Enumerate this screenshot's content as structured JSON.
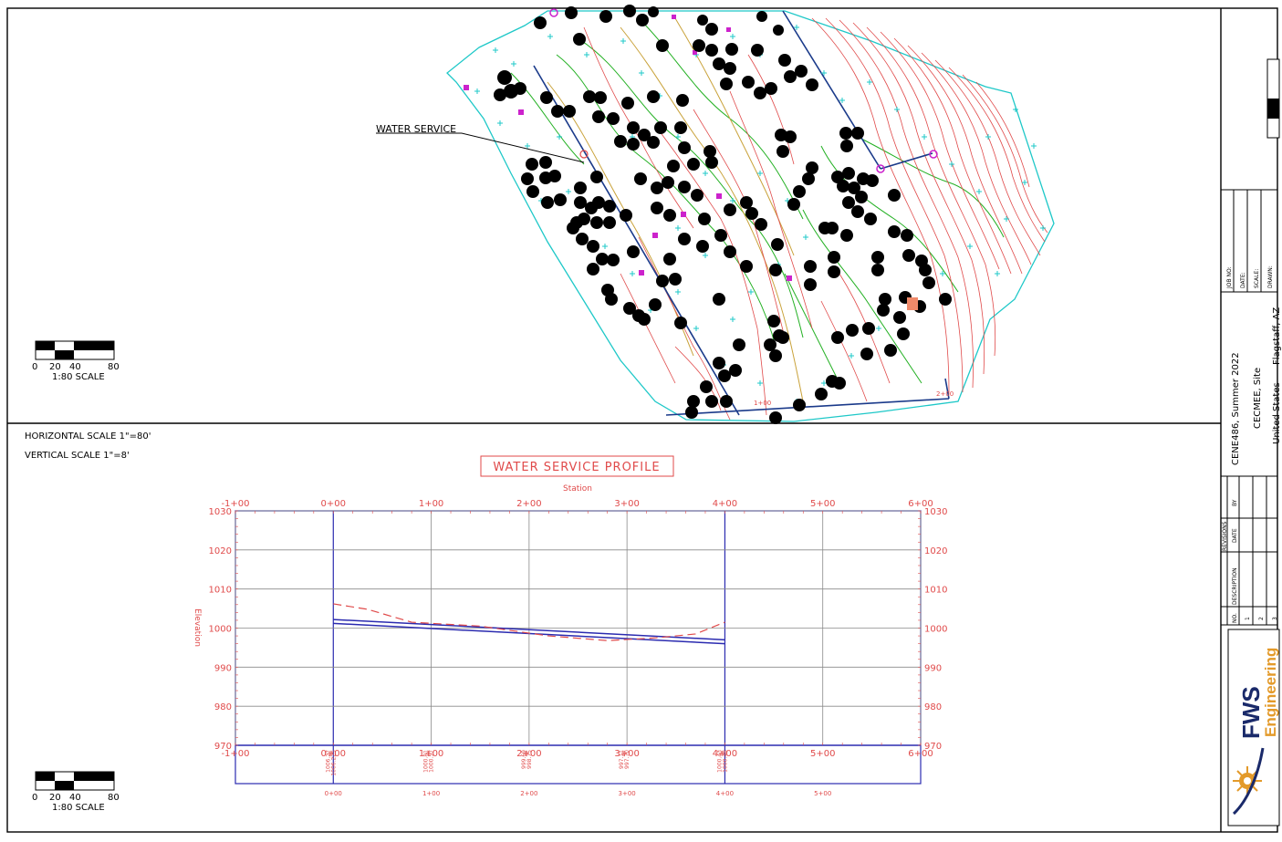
{
  "site_plan": {
    "callout_label": "WATER SERVICE",
    "scale_bar": {
      "ticks": [
        "0",
        "20",
        "40",
        "80"
      ],
      "caption": "1:80 SCALE"
    },
    "station_labels": [
      "1+00",
      "2+00"
    ]
  },
  "profile": {
    "horizontal_scale": "HORIZONTAL SCALE 1\"=80'",
    "vertical_scale": "VERTICAL SCALE 1\"=8'",
    "scale_bar": {
      "ticks": [
        "0",
        "20",
        "40",
        "80"
      ],
      "caption": "1:80 SCALE"
    }
  },
  "title_block": {
    "field_labels": [
      "JOB NO:",
      "DATE:",
      "SCALE:",
      "DRAWN:"
    ],
    "project_lines": [
      "CENE486, Summer 2022",
      "CECMEE, Site",
      "United States",
      "Flagstaff, AZ"
    ],
    "revisions": {
      "heading": "REVISIONS",
      "columns": [
        "NO.",
        "DESCRIPTION",
        "DATE",
        "BY"
      ],
      "rows": [
        "1",
        "2",
        "3"
      ]
    },
    "logo": {
      "line1": "FWS",
      "line2": "Engineering"
    }
  },
  "colors": {
    "contour_red": "#e04a4a",
    "cyan": "#1ec8c8",
    "green": "#22b022",
    "blue_frame": "#2b2bb0",
    "logo_orange": "#e39a2a"
  },
  "chart_data": {
    "type": "line",
    "title": "WATER SERVICE PROFILE",
    "xlabel": "Station",
    "ylabel": "Elevation",
    "x_ticks": [
      "-1+00",
      "0+00",
      "1+00",
      "2+00",
      "3+00",
      "4+00",
      "5+00",
      "6+00"
    ],
    "y_ticks": [
      "970",
      "980",
      "990",
      "1000",
      "1010",
      "1020",
      "1030"
    ],
    "x_range": [
      -100,
      600
    ],
    "ylim": [
      970,
      1030
    ],
    "grid": true,
    "series": [
      {
        "x": [
          0,
          400
        ],
        "y": [
          1002.2,
          997.0
        ]
      },
      {
        "x": [
          0,
          400
        ],
        "y": [
          1001.2,
          996.0
        ]
      },
      {
        "x": [
          0,
          35,
          80,
          150,
          220,
          280,
          330,
          370,
          400
        ],
        "y": [
          1006.2,
          1004.8,
          1001.5,
          1000.5,
          998.0,
          996.8,
          997.5,
          998.5,
          1001.5
        ]
      }
    ],
    "station_annotations": [
      {
        "station": 0,
        "labels": [
          "1006.27",
          "1006.225"
        ]
      },
      {
        "station": 100,
        "labels": [
          "1000.81",
          "1000.57"
        ]
      },
      {
        "station": 200,
        "labels": [
          "999.69",
          "998.75"
        ]
      },
      {
        "station": 300,
        "labels": [
          "997.11",
          "997.70"
        ]
      },
      {
        "station": 400,
        "labels": [
          "1000.43",
          "1000.48"
        ]
      }
    ],
    "bottom_station_labels": [
      "0+00",
      "1+00",
      "2+00",
      "3+00",
      "4+00",
      "5+00"
    ]
  }
}
